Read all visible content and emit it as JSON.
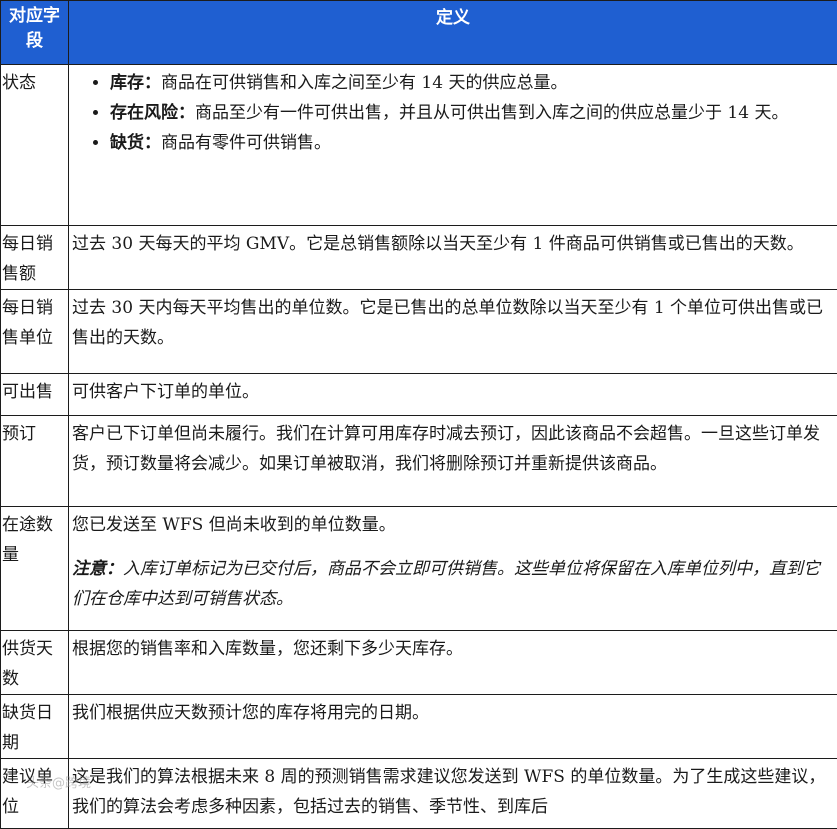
{
  "header": {
    "field": "对应字段",
    "definition": "定义"
  },
  "rows": {
    "status": {
      "field": "状态",
      "items": [
        {
          "term": "库存：",
          "text": "商品在可供销售和入库之间至少有 14 天的供应总量。"
        },
        {
          "term": "存在风险：",
          "text": "商品至少有一件可供出售，并且从可供出售到入库之间的供应总量少于 14 天。"
        },
        {
          "term": "缺货：",
          "text": "商品有零件可供销售。"
        }
      ]
    },
    "daily_sales": {
      "field": "每日销售额",
      "definition": "过去 30 天每天的平均 GMV。它是总销售额除以当天至少有 1 件商品可供销售或已售出的天数。"
    },
    "daily_units": {
      "field": "每日销售单位",
      "definition": "过去 30 天内每天平均售出的单位数。它是已售出的总单位数除以当天至少有 1 个单位可供出售或已售出的天数。"
    },
    "available": {
      "field": "可出售",
      "definition": "可供客户下订单的单位。"
    },
    "reserved": {
      "field": "预订",
      "definition": "客户已下订单但尚未履行。我们在计算可用库存时减去预订，因此该商品不会超售。一旦这些订单发货，预订数量将会减少。如果订单被取消，我们将删除预订并重新提供该商品。"
    },
    "in_transit": {
      "field": "在途数量",
      "definition": "您已发送至 WFS 但尚未收到的单位数量。",
      "note_label": "注意：",
      "note_text": "入库订单标记为已交付后，商品不会立即可供销售。这些单位将保留在入库单位列中，直到它们在仓库中达到可销售状态。"
    },
    "days_of_supply": {
      "field": "供货天数",
      "definition": "根据您的销售率和入库数量，您还剩下多少天库存。"
    },
    "stockout_date": {
      "field": "缺货日期",
      "definition": "我们根据供应天数预计您的库存将用完的日期。"
    },
    "suggested_units": {
      "field": "建议单位",
      "definition": "这是我们的算法根据未来 8 周的预测销售需求建议您发送到 WFS 的单位数量。为了生成这些建议，我们的算法会考虑多种因素，包括过去的销售、季节性、到库后"
    }
  },
  "watermark": "头条@跨境"
}
